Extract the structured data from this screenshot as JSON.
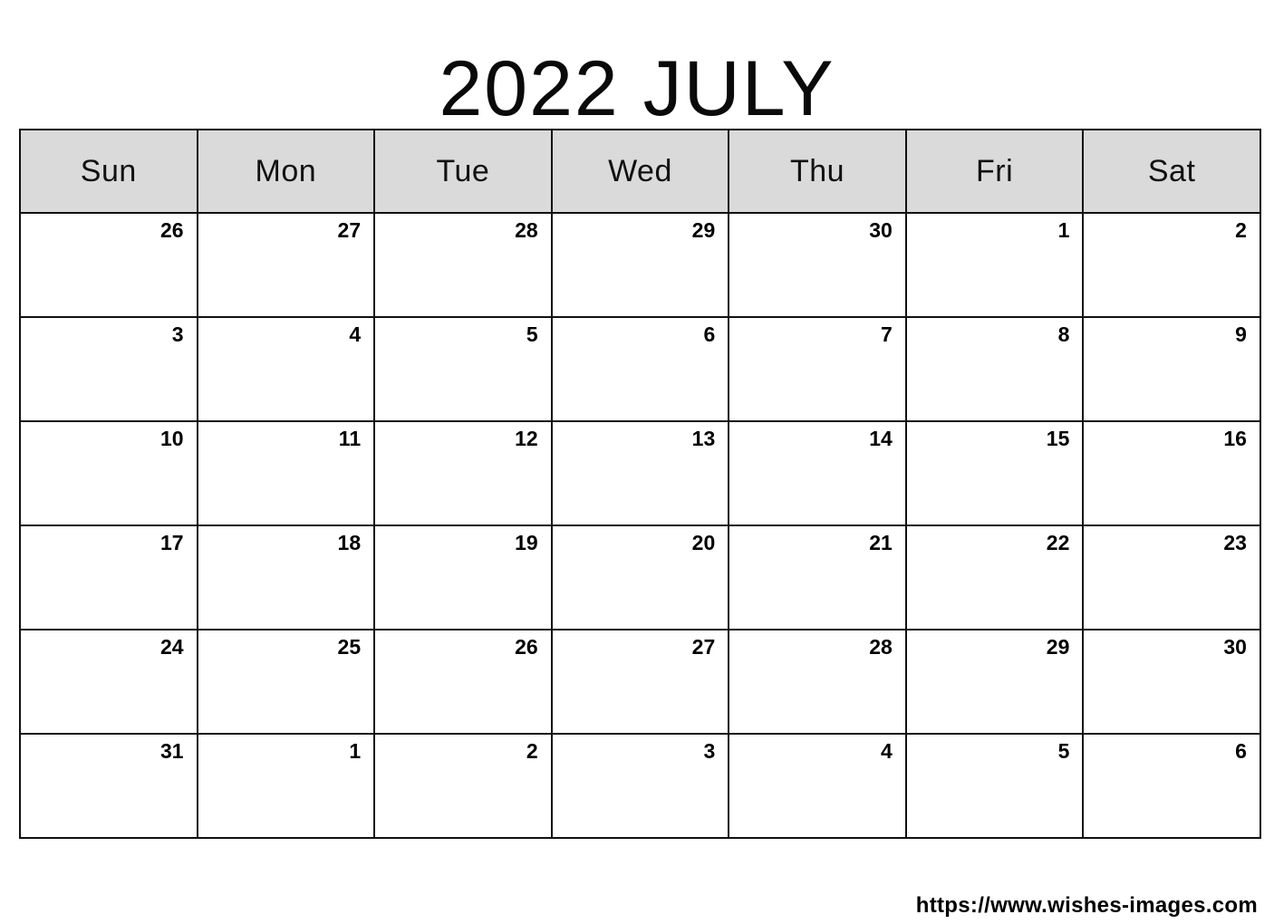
{
  "title": "2022 JULY",
  "year": 2022,
  "month": "JULY",
  "weekdays": [
    "Sun",
    "Mon",
    "Tue",
    "Wed",
    "Thu",
    "Fri",
    "Sat"
  ],
  "weeks": [
    {
      "days": [
        "26",
        "27",
        "28",
        "29",
        "30",
        "1",
        "2"
      ]
    },
    {
      "days": [
        "3",
        "4",
        "5",
        "6",
        "7",
        "8",
        "9"
      ]
    },
    {
      "days": [
        "10",
        "11",
        "12",
        "13",
        "14",
        "15",
        "16"
      ]
    },
    {
      "days": [
        "17",
        "18",
        "19",
        "20",
        "21",
        "22",
        "23"
      ]
    },
    {
      "days": [
        "24",
        "25",
        "26",
        "27",
        "28",
        "29",
        "30"
      ]
    },
    {
      "days": [
        "31",
        "1",
        "2",
        "3",
        "4",
        "5",
        "6"
      ]
    }
  ],
  "footer": {
    "url": "https://www.wishes-images.com"
  },
  "colors": {
    "header_background": "#dadada",
    "grid_line": "#111111",
    "cell_background": "#ffffff",
    "text": "#000000",
    "page_background": "#ffffff"
  }
}
